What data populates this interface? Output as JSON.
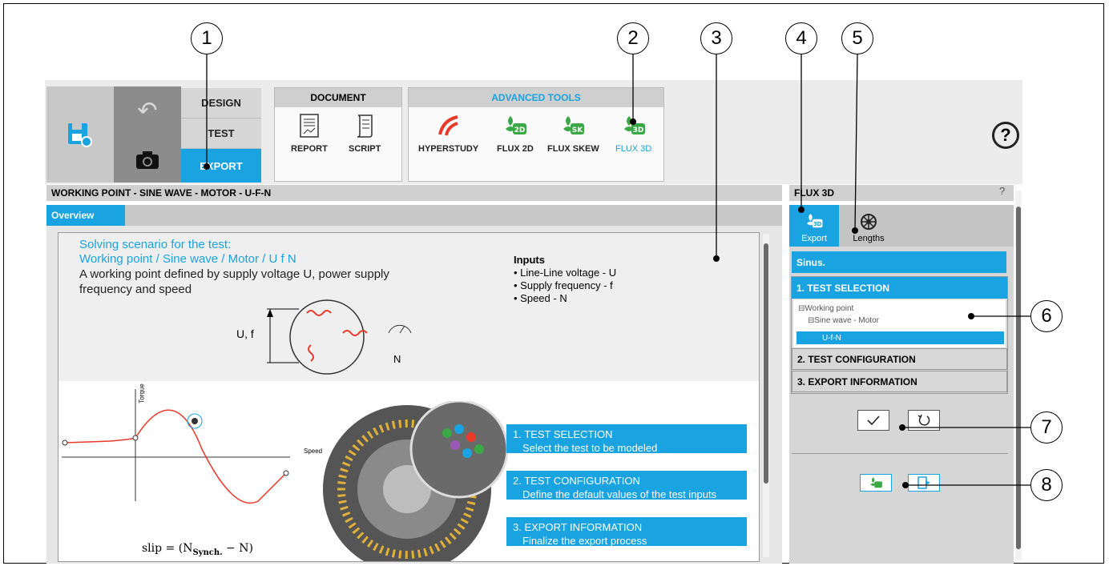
{
  "callouts": [
    "1",
    "2",
    "3",
    "4",
    "5",
    "6",
    "7",
    "8"
  ],
  "ribbon": {
    "modes": {
      "design": "DESIGN",
      "test": "TEST",
      "export": "EXPORT"
    },
    "document": {
      "title": "DOCUMENT",
      "report": "REPORT",
      "script": "SCRIPT"
    },
    "advanced": {
      "title": "ADVANCED TOOLS",
      "hyperstudy": "HYPERSTUDY",
      "flux2d": "FLUX 2D",
      "fluxskew": "FLUX SKEW",
      "flux3d": "FLUX 3D"
    },
    "help": "?"
  },
  "left_panel": {
    "title": "WORKING POINT - SINE WAVE - MOTOR - U-F-N",
    "tab": "Overview",
    "scenario_line1": "Solving scenario for the test:",
    "scenario_line2": "Working point / Sine wave / Motor / U f N",
    "description": "A working point defined by supply voltage U, power supply frequency and speed",
    "inputs_title": "Inputs",
    "inputs": [
      "Line-Line voltage - U",
      "Supply frequency - f",
      "Speed - N"
    ],
    "diagram_uf": "U, f",
    "diagram_n": "N",
    "graph_torque": "Torque",
    "graph_speed": "Speed",
    "slip_formula": "slip = (N",
    "slip_sub": "Synch.",
    "slip_tail": " − N)",
    "steps": [
      {
        "title": "1. TEST SELECTION",
        "desc": "Select the test to be modeled"
      },
      {
        "title": "2. TEST CONFIGURATION",
        "desc": "Define the default values of the test inputs"
      },
      {
        "title": "3. EXPORT INFORMATION",
        "desc": "Finalize the export process"
      }
    ]
  },
  "right_panel": {
    "title": "FLUX 3D",
    "help": "?",
    "tabs": {
      "export": "Export",
      "lengths": "Lengths"
    },
    "sinus": "Sinus.",
    "sections": {
      "test_selection": "1. TEST SELECTION",
      "test_config": "2. TEST CONFIGURATION",
      "export_info": "3. EXPORT INFORMATION"
    },
    "tree": {
      "root": "⊟Working point",
      "child": "⊟Sine wave - Motor",
      "leaf": "U-f-N"
    }
  },
  "colors": {
    "accent": "#19a3e0",
    "hyperstudy": "#e8392a",
    "flux_green": "#3aa844"
  }
}
